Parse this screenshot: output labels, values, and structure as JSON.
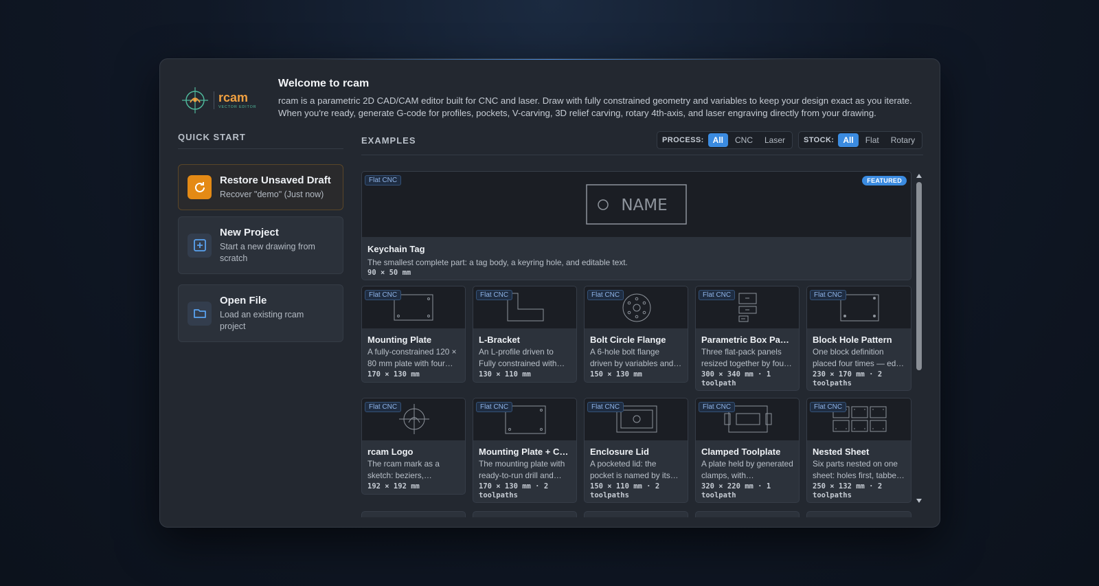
{
  "app": {
    "name": "rcam",
    "subtitle": "VECTOR EDITOR"
  },
  "welcome": {
    "title": "Welcome to rcam",
    "description": "rcam is a parametric 2D CAD/CAM editor built for CNC and laser. Draw with fully constrained geometry and variables to keep your design exact as you iterate. When you're ready, generate G-code for profiles, pockets, V-carving, 3D relief carving, rotary 4th-axis, and laser engraving directly from your drawing."
  },
  "quick_start": {
    "title": "QUICK START",
    "items": [
      {
        "label": "Restore Unsaved Draft",
        "sub": "Recover \"demo\" (Just now)",
        "icon": "restore-icon"
      },
      {
        "label": "New Project",
        "sub": "Start a new drawing from scratch",
        "icon": "plus-square-icon"
      },
      {
        "label": "Open File",
        "sub": "Load an existing rcam project",
        "icon": "folder-icon"
      }
    ]
  },
  "examples": {
    "title": "EXAMPLES",
    "process_filter": {
      "label": "PROCESS:",
      "options": [
        "All",
        "CNC",
        "Laser"
      ],
      "selected": "All"
    },
    "stock_filter": {
      "label": "STOCK:",
      "options": [
        "All",
        "Flat",
        "Rotary"
      ],
      "selected": "All"
    },
    "featured": {
      "badge": "Flat CNC",
      "featured_label": "FEATURED",
      "preview_text": "NAME",
      "name": "Keychain Tag",
      "desc": "The smallest complete part: a tag body, a keyring hole, and editable text.",
      "dims": "90 × 50 mm"
    },
    "cards": [
      {
        "badge": "Flat CNC",
        "name": "Mounting Plate",
        "desc": "A fully-constrained 120 × 80 mm plate with four…",
        "dims": "170 × 130 mm"
      },
      {
        "badge": "Flat CNC",
        "name": "L-Bracket",
        "desc": "An L-profile driven to Fully constrained with…",
        "dims": "130 × 110 mm"
      },
      {
        "badge": "Flat CNC",
        "name": "Bolt Circle Flange",
        "desc": "A 6-hole bolt flange driven by variables and…",
        "dims": "150 × 130 mm"
      },
      {
        "badge": "Flat CNC",
        "name": "Parametric Box Panels",
        "desc": "Three flat-pack panels resized together by fou…",
        "dims": "300 × 340 mm · 1 toolpath"
      },
      {
        "badge": "Flat CNC",
        "name": "Block Hole Pattern",
        "desc": "One block definition placed four times — ed…",
        "dims": "230 × 170 mm · 2 toolpaths"
      },
      {
        "badge": "Flat CNC",
        "name": "rcam Logo",
        "desc": "The rcam mark as a sketch: beziers,…",
        "dims": "192 × 192 mm"
      },
      {
        "badge": "Flat CNC",
        "name": "Mounting Plate + C…",
        "desc": "The mounting plate with ready-to-run drill and…",
        "dims": "170 × 130 mm · 2 toolpaths"
      },
      {
        "badge": "Flat CNC",
        "name": "Enclosure Lid",
        "desc": "A pocketed lid: the pocket is named by its…",
        "dims": "150 × 110 mm · 2 toolpaths"
      },
      {
        "badge": "Flat CNC",
        "name": "Clamped Toolplate",
        "desc": "A plate held by generated clamps, with…",
        "dims": "320 × 220 mm · 1 toolpath"
      },
      {
        "badge": "Flat CNC",
        "name": "Nested Sheet",
        "desc": "Six parts nested on one sheet: holes first, tabbe…",
        "dims": "250 × 132 mm · 2 toolpaths"
      }
    ]
  },
  "colors": {
    "accent": "#3b8be0",
    "draft": "#e48a15",
    "logo": "#f0a040"
  }
}
